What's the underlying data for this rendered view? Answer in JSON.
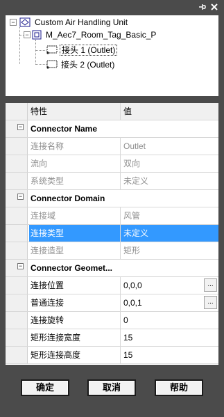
{
  "tree": {
    "root_label": "Custom Air Handling Unit",
    "family_label": "M_Aec7_Room_Tag_Basic_P",
    "connector1_label": "接头 1 (Outlet)",
    "connector2_label": "接头 2 (Outlet)"
  },
  "grid": {
    "header_property": "特性",
    "header_value": "值",
    "rows": [
      {
        "type": "category",
        "name": "Connector Name"
      },
      {
        "type": "prop",
        "name": "连接名称",
        "value": "Outlet",
        "disabled": true
      },
      {
        "type": "prop",
        "name": "流向",
        "value": "双向",
        "disabled": true
      },
      {
        "type": "prop",
        "name": "系统类型",
        "value": "未定义",
        "disabled": true
      },
      {
        "type": "category",
        "name": "Connector Domain"
      },
      {
        "type": "prop",
        "name": "连接域",
        "value": "风管",
        "disabled": true
      },
      {
        "type": "prop",
        "name": "连接类型",
        "value": "未定义",
        "disabled": false,
        "selected": true
      },
      {
        "type": "prop",
        "name": "连接造型",
        "value": "矩形",
        "disabled": true
      },
      {
        "type": "category",
        "name": "Connector Geomet..."
      },
      {
        "type": "prop",
        "name": "连接位置",
        "value": "0,0,0",
        "disabled": false,
        "ellipsis": true
      },
      {
        "type": "prop",
        "name": "普通连接",
        "value": "0,0,1",
        "disabled": false,
        "ellipsis": true
      },
      {
        "type": "prop",
        "name": "连接旋转",
        "value": "0",
        "disabled": false
      },
      {
        "type": "prop",
        "name": "矩形连接宽度",
        "value": "15",
        "disabled": false
      },
      {
        "type": "prop",
        "name": "矩形连接高度",
        "value": "15",
        "disabled": false
      }
    ],
    "ellipsis_label": "..."
  },
  "buttons": {
    "ok": "确定",
    "cancel": "取消",
    "help": "帮助"
  },
  "titlebar": {
    "pin_icon": "pin-icon",
    "close_icon": "close-icon"
  }
}
